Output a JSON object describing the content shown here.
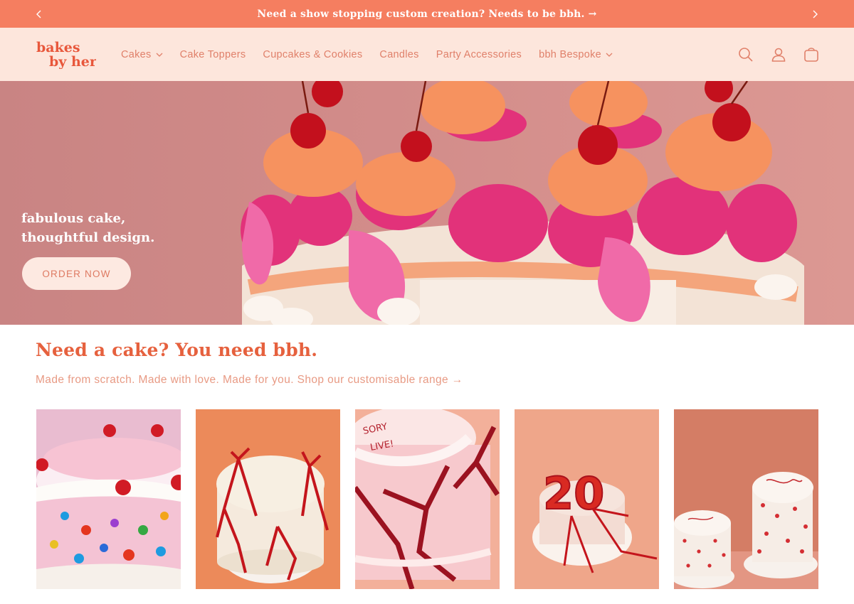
{
  "announcement": {
    "message": "Need a show stopping custom creation? Needs to be bbh. →",
    "prev_icon": "chevron-left-icon",
    "next_icon": "chevron-right-icon"
  },
  "header": {
    "logo_line1": "bakes",
    "logo_line2": "by her",
    "nav": [
      {
        "label": "Cakes",
        "has_dropdown": true
      },
      {
        "label": "Cake Toppers",
        "has_dropdown": false
      },
      {
        "label": "Cupcakes & Cookies",
        "has_dropdown": false
      },
      {
        "label": "Candles",
        "has_dropdown": false
      },
      {
        "label": "Party Accessories",
        "has_dropdown": false
      },
      {
        "label": "bbh Bespoke",
        "has_dropdown": true
      }
    ],
    "icons": [
      "search-icon",
      "account-icon",
      "cart-icon"
    ]
  },
  "hero": {
    "line1": "fabulous cake,",
    "line2": "thoughtful design.",
    "button_label": "ORDER NOW"
  },
  "section": {
    "title": "Need a cake? You need bbh.",
    "subtitle": "Made from scratch. Made with love. Made for you. Shop our customisable range →"
  },
  "products": [
    {
      "image": "jewelled-cherry-cake"
    },
    {
      "image": "red-ribbon-vintage-cake"
    },
    {
      "image": "pink-sorry-cake-with-bows"
    },
    {
      "image": "twenty-balloon-cake"
    },
    {
      "image": "heart-print-mini-cakes"
    }
  ],
  "colors": {
    "accent": "#f57e60",
    "header_bg": "#fde6dc",
    "title": "#e6613e",
    "nav_text": "#e0806a"
  }
}
